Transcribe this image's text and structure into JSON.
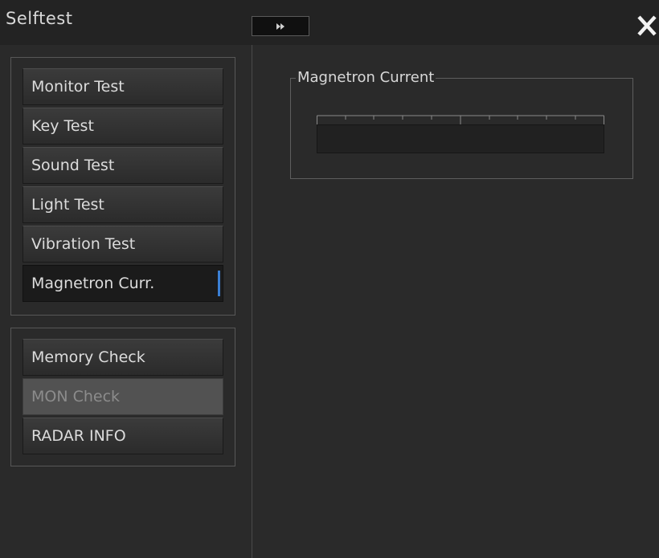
{
  "window": {
    "title": "Selftest",
    "forward_icon": "double-chevron-right-icon",
    "close_icon": "close-icon"
  },
  "test_menu": {
    "items": [
      {
        "label": "Monitor Test",
        "state": "normal"
      },
      {
        "label": "Key Test",
        "state": "normal"
      },
      {
        "label": "Sound Test",
        "state": "normal"
      },
      {
        "label": "Light Test",
        "state": "normal"
      },
      {
        "label": "Vibration Test",
        "state": "normal"
      },
      {
        "label": "Magnetron Curr.",
        "state": "selected"
      }
    ]
  },
  "check_menu": {
    "items": [
      {
        "label": "Memory Check",
        "state": "normal"
      },
      {
        "label": "MON Check",
        "state": "disabled"
      },
      {
        "label": "RADAR INFO",
        "state": "normal"
      }
    ]
  },
  "magnetron_panel": {
    "title": "Magnetron Current",
    "level": 0
  },
  "colors": {
    "background": "#2a2a2a",
    "selection_indicator": "#3b7fd4",
    "text": "#dcdcdc",
    "disabled_text": "#8c8c8c"
  }
}
